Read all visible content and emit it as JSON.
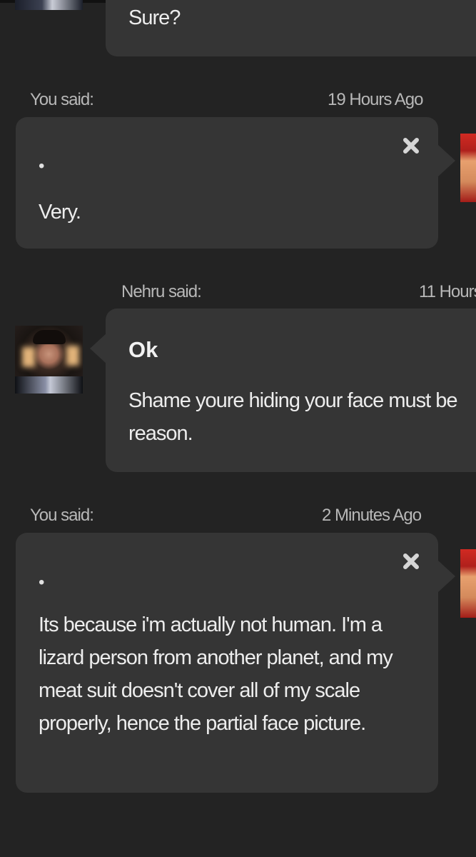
{
  "messages": [
    {
      "id": "m0",
      "body": "Sure?"
    },
    {
      "id": "m1",
      "speaker_label": "You said:",
      "timestamp": "19 Hours Ago",
      "bullet": "•",
      "body": "Very."
    },
    {
      "id": "m2",
      "speaker_label": "Nehru said:",
      "timestamp": "11 Hours",
      "heading": "Ok",
      "body": "Shame youre hiding your face must be reason."
    },
    {
      "id": "m3",
      "speaker_label": "You said:",
      "timestamp": "2 Minutes Ago",
      "bullet": "•",
      "body": "Its because i'm actually not human. I'm a lizard person from another planet, and my meat suit doesn't cover all of my scale properly, hence the partial face picture."
    }
  ],
  "icons": {
    "delete": "close-x-icon"
  },
  "colors": {
    "background": "#232323",
    "bubble": "#353535",
    "meta_text": "#b8b8b8",
    "body_text": "#ededed"
  }
}
